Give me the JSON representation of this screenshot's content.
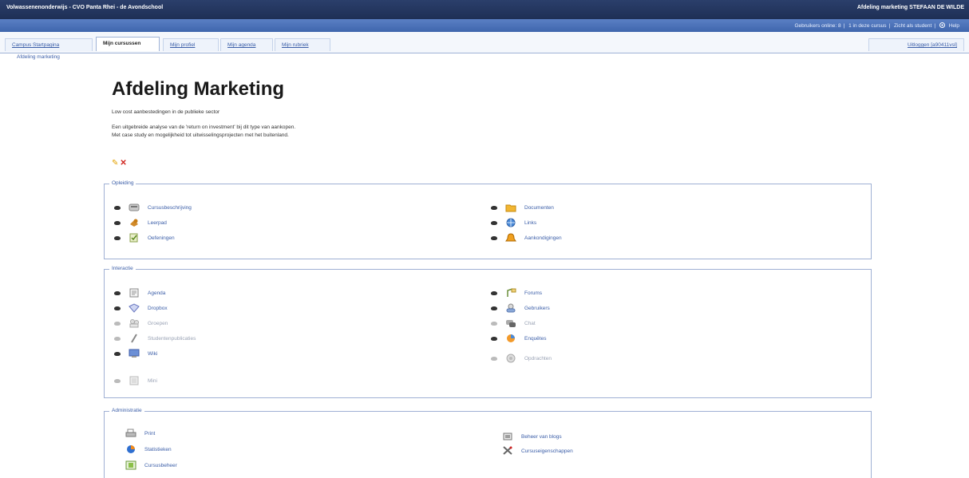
{
  "header": {
    "site_title": "Volwassenenonderwijs - CVO Panta Rhei - de Avondschool",
    "user": "Afdeling marketing STEFAAN DE WILDE",
    "links": [
      "Gebruikers online: 8",
      "1 in deze cursus",
      "Zicht als student",
      "Help"
    ],
    "help_icon": "help-icon"
  },
  "tabs": [
    {
      "label": "Campus Startpagina",
      "active": false
    },
    {
      "label": "Mijn cursussen",
      "active": true
    },
    {
      "label": "Mijn profiel",
      "active": false
    },
    {
      "label": "Mijn agenda",
      "active": false
    },
    {
      "label": "Mijn rubriek",
      "active": false
    }
  ],
  "logout": "Uitloggen [a90411vsl]",
  "breadcrumb": "Afdeling marketing",
  "page": {
    "title": "Afdeling Marketing",
    "subtitle": "Low cost aanbestedingen in de publieke sector",
    "desc_line1": "Een uitgebreide analyse van de 'return on investment' bij dit type van aankopen.",
    "desc_line2": "Met case study en mogelijkheid tot uitwisselingsprojecten met het buitenland."
  },
  "tools": {
    "edit_symbol": "✎",
    "delete_symbol": "✕"
  },
  "sections": {
    "opleiding": {
      "legend": "Opleiding",
      "left": [
        {
          "label": "Cursusbeschrijving",
          "icon": "course-description-icon"
        },
        {
          "label": "Leerpad",
          "icon": "learning-path-icon"
        },
        {
          "label": "Oefeningen",
          "icon": "exercises-icon"
        }
      ],
      "right": [
        {
          "label": "Documenten",
          "icon": "folder-icon"
        },
        {
          "label": "Links",
          "icon": "links-icon"
        },
        {
          "label": "Aankondigingen",
          "icon": "announcements-icon"
        }
      ]
    },
    "interactie": {
      "legend": "Interactie",
      "left": [
        {
          "label": "Agenda",
          "icon": "agenda-icon",
          "disabled": false
        },
        {
          "label": "Dropbox",
          "icon": "dropbox-icon",
          "disabled": false
        },
        {
          "label": "Groepen",
          "icon": "groups-icon",
          "disabled": true
        },
        {
          "label": "Studentenpublicaties",
          "icon": "student-publications-icon",
          "disabled": true
        },
        {
          "label": "Wiki",
          "icon": "wiki-icon",
          "disabled": false
        },
        {
          "label": "Mini",
          "icon": "mini-icon",
          "disabled": true
        }
      ],
      "right": [
        {
          "label": "Forums",
          "icon": "forums-icon",
          "disabled": false
        },
        {
          "label": "Gebruikers",
          "icon": "users-icon",
          "disabled": false
        },
        {
          "label": "Chat",
          "icon": "chat-icon",
          "disabled": true
        },
        {
          "label": "Enquêtes",
          "icon": "survey-icon",
          "disabled": false
        },
        {
          "label": "Opdrachten",
          "icon": "assignments-icon",
          "disabled": true
        }
      ]
    },
    "administratie": {
      "legend": "Administratie",
      "left": [
        {
          "label": "Print",
          "icon": "print-icon"
        },
        {
          "label": "Statistieken",
          "icon": "statistics-icon"
        },
        {
          "label": "Cursusbeheer",
          "icon": "course-settings-icon"
        }
      ],
      "right": [
        {
          "label": "Beheer van blogs",
          "icon": "blogs-icon"
        },
        {
          "label": "Cursuseigenschappen",
          "icon": "course-properties-icon"
        }
      ]
    }
  },
  "colors": {
    "header": "#1e2f55",
    "subbar": "#3f66ad",
    "link": "#3b5ea8",
    "border": "#9fb0d4"
  }
}
